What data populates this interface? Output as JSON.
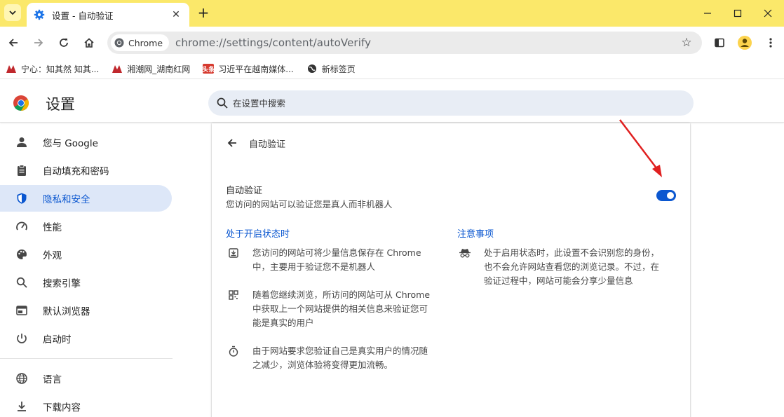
{
  "tabstrip": {
    "tab_title": "设置 - 自动验证",
    "new_tab": "+",
    "close": "✕"
  },
  "toolbar": {
    "chip_label": "Chrome",
    "url": "chrome://settings/content/autoVerify"
  },
  "bookmarks": [
    {
      "label": "宁心：知其然 知其...",
      "color": "#c0282d"
    },
    {
      "label": "湘潮网_湖南红网",
      "color": "#c0282d"
    },
    {
      "label": "习近平在越南媒体...",
      "color": "#d63a2f"
    },
    {
      "label": "新标签页",
      "color": "#333333"
    }
  ],
  "settings": {
    "title": "设置",
    "search_placeholder": "在设置中搜索"
  },
  "sidebar": {
    "items": [
      {
        "label": "您与 Google",
        "icon": "person-icon"
      },
      {
        "label": "自动填充和密码",
        "icon": "clipboard-icon"
      },
      {
        "label": "隐私和安全",
        "icon": "shield-icon"
      },
      {
        "label": "性能",
        "icon": "speedometer-icon"
      },
      {
        "label": "外观",
        "icon": "palette-icon"
      },
      {
        "label": "搜索引擎",
        "icon": "search-icon"
      },
      {
        "label": "默认浏览器",
        "icon": "browser-icon"
      },
      {
        "label": "启动时",
        "icon": "power-icon"
      },
      {
        "label": "语言",
        "icon": "globe-icon"
      },
      {
        "label": "下载内容",
        "icon": "download-icon"
      }
    ],
    "active_index": 2
  },
  "page": {
    "subtitle": "自动验证",
    "setting_label": "自动验证",
    "setting_desc": "您访问的网站可以验证您是真人而非机器人",
    "toggle_on": true,
    "accent": "#0b57d0",
    "left_heading": "处于开启状态时",
    "right_heading": "注意事项",
    "left_items": [
      {
        "icon": "save-icon",
        "text": "您访问的网站可将少量信息保存在 Chrome 中，主要用于验证您不是机器人"
      },
      {
        "icon": "grid-icon",
        "text": "随着您继续浏览，所访问的网站可从 Chrome 中获取上一个网站提供的相关信息来验证您可能是真实的用户"
      },
      {
        "icon": "timer-icon",
        "text": "由于网站要求您验证自己是真实用户的情况随之减少，浏览体验将变得更加流畅。"
      }
    ],
    "right_items": [
      {
        "icon": "incognito-icon",
        "text": "处于启用状态时，此设置不会识别您的身份，也不会允许网站查看您的浏览记录。不过，在验证过程中，网站可能会分享少量信息"
      }
    ]
  }
}
